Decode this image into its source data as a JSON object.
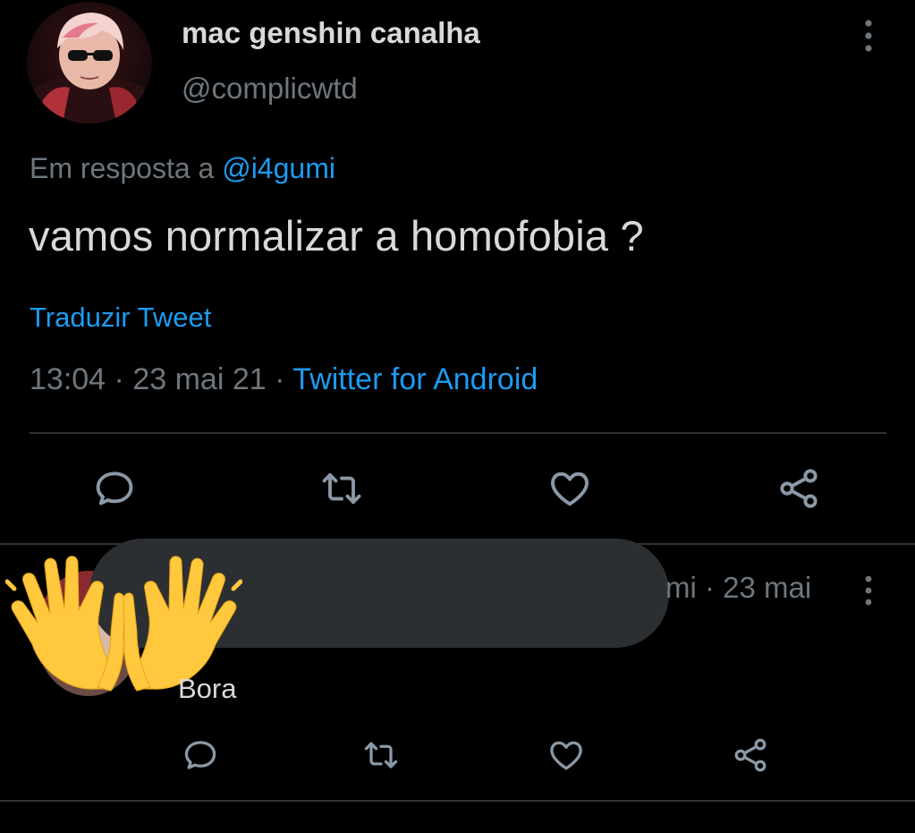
{
  "main_tweet": {
    "display_name": "mac genshin canalha",
    "handle": "@complicwtd",
    "reply_prefix": "Em resposta a",
    "reply_to": "@i4gumi",
    "text": "vamos normalizar a homofobia ?",
    "translate_label": "Traduzir Tweet",
    "time": "13:04",
    "date": "23 mai 21",
    "separator": "·",
    "source": "Twitter for Android",
    "actions": [
      "reply-icon",
      "retweet-icon",
      "like-icon",
      "share-icon"
    ]
  },
  "reply_tweet": {
    "time_fragment": "mi · 23 mai",
    "body": "Bora",
    "overlay_emoji": "raised-hands-emoji",
    "actions": [
      "reply-icon",
      "retweet-icon",
      "like-icon",
      "share-icon"
    ]
  },
  "colors": {
    "background": "#000000",
    "text": "#d9d9d9",
    "muted": "#6e767d",
    "accent": "#1d9bf0",
    "divider": "#2f3336"
  }
}
